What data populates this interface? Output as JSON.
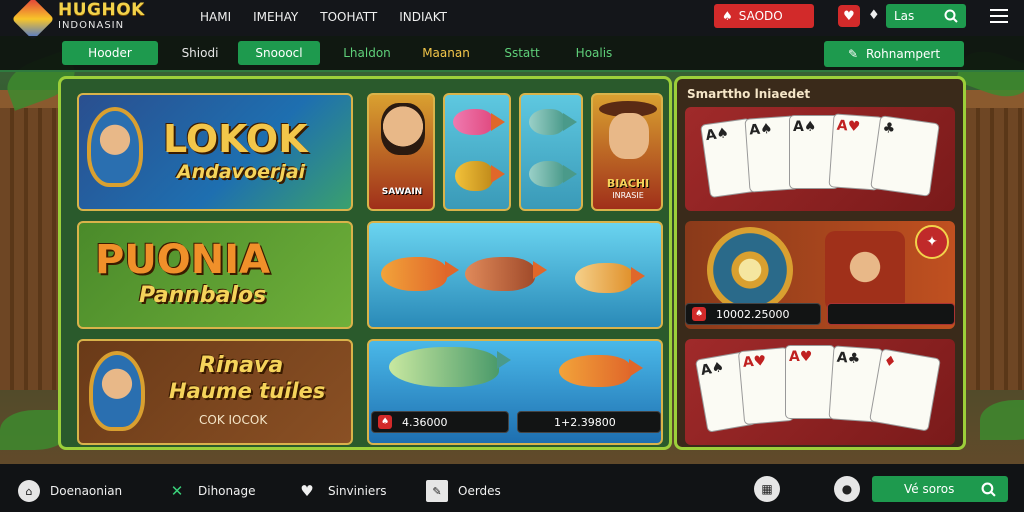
{
  "header": {
    "logo_title": "HUGHOK",
    "logo_subtitle": "INDONASIN",
    "nav": [
      "HAMI",
      "IMEHAY",
      "TOOHATT",
      "INDIAKT"
    ],
    "red_button": "SAODO",
    "lang_button": "Las"
  },
  "subnav": {
    "tabs": [
      "Hooder",
      "Shiodi",
      "Snooocl",
      "Lhaldon",
      "Maanan",
      "Sstatt",
      "Hoalis"
    ],
    "action_button": "Rohnampert"
  },
  "games": {
    "tile1_title": "LOKOK",
    "tile1_subtitle": "Andavoerjai",
    "tile2_title": "PUONIA",
    "tile2_subtitle": "Pannbalos",
    "tile3_title": "Rinava",
    "tile3_subtitle": "Haume tuiles",
    "tile3_tag": "COK IOCOK",
    "char1_label": "SAWAIN",
    "char2_label": "BIACHI",
    "char2_sub": "INRASIE",
    "value_left": "4.36000",
    "value_right": "1+2.39800"
  },
  "side": {
    "title": "Smarttho lniaedet",
    "value": "10002.25000"
  },
  "bottom": {
    "items": [
      "Doenaonian",
      "Dihonage",
      "Sinviniers",
      "Oerdes"
    ],
    "search_label": "Vé soros"
  },
  "icons": {
    "menu": "menu-icon",
    "search": "search-icon",
    "heart": "heart-icon"
  },
  "colors": {
    "accent_green": "#1e9a4e",
    "accent_red": "#d22a2a",
    "frame_lime": "#9ccf3a",
    "gold": "#f2d24a"
  }
}
